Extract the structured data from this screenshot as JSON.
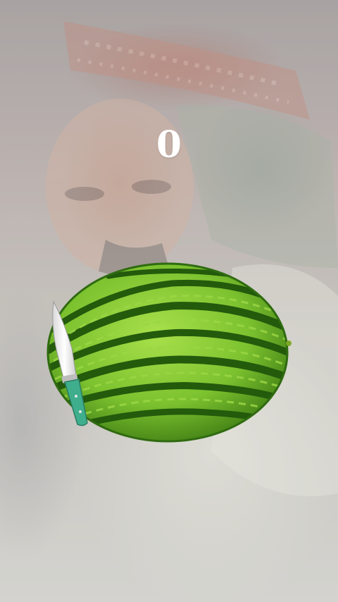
{
  "game": {
    "score": "0"
  },
  "scene": {
    "fruit": "watermelon",
    "blade": "knife-icon",
    "background": "front-camera-feed"
  },
  "colors": {
    "score_text": "#ffffff",
    "rind_light": "#8fd13a",
    "rind_dark": "#2f6b10",
    "knife_handle": "#3fae8c",
    "knife_blade": "#f2f2f2"
  }
}
